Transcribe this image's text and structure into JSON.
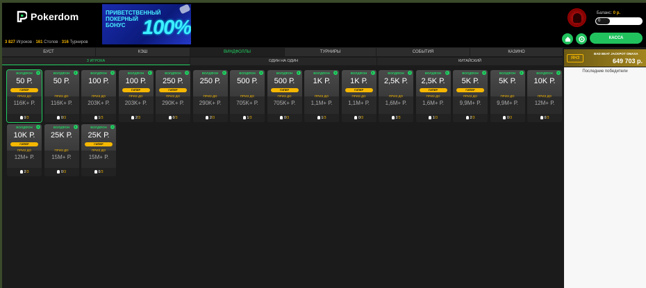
{
  "brand": {
    "name": "Pokerdom"
  },
  "stats": {
    "players_value": "3 827",
    "players_label": "Игроков",
    "tables_value": "161",
    "tables_label": "Столов",
    "tournaments_value": "316",
    "tournaments_label": "Турниров"
  },
  "banner": {
    "lines": [
      "ПРИВЕТСТВЕННЫЙ",
      "ПОКЕРНЫЙ",
      "БОНУС"
    ],
    "percent": "100%"
  },
  "account": {
    "balance_label": "Баланс:",
    "balance_value": "0 р.",
    "toggle_value": "0",
    "cashier_label": "КАССА"
  },
  "tabs_main": [
    {
      "label": "БУСТ",
      "active": false
    },
    {
      "label": "КЭШ",
      "active": false
    },
    {
      "label": "ВИНДФОЛЛЫ",
      "active": true
    },
    {
      "label": "ТУРНИРЫ",
      "active": false
    },
    {
      "label": "СОБЫТИЯ",
      "active": false
    },
    {
      "label": "КАЗИНО",
      "active": false
    }
  ],
  "tabs_sub": [
    {
      "label": "3 ИГРОКА",
      "active": true
    },
    {
      "label": "ОДИН НА ОДИН",
      "active": false
    },
    {
      "label": "КИТАЙСКИЙ",
      "active": false
    }
  ],
  "cards": [
    {
      "tag": "ВОЛДФОН",
      "bet": "50 Р.",
      "hyper": "ГИПЕР",
      "prize_label": "ПРИЗ ДО",
      "prize": "116K+ Р.",
      "players": "0",
      "max": "3",
      "selected": true
    },
    {
      "tag": "ВОЛДФОН",
      "bet": "50 Р.",
      "hyper": "",
      "prize_label": "ПРИЗ ДО",
      "prize": "116K+ Р.",
      "players": "0",
      "max": "3",
      "selected": false
    },
    {
      "tag": "ВОЛДФОН",
      "bet": "100 Р.",
      "hyper": "",
      "prize_label": "ПРИЗ ДО",
      "prize": "203K+ Р.",
      "players": "1",
      "max": "3",
      "selected": false
    },
    {
      "tag": "ВОЛДФОН",
      "bet": "100 Р.",
      "hyper": "ГИПЕР",
      "prize_label": "ПРИЗ ДО",
      "prize": "203K+ Р.",
      "players": "2",
      "max": "3",
      "selected": false
    },
    {
      "tag": "ВОЛДФОН",
      "bet": "250 Р.",
      "hyper": "ГИПЕР",
      "prize_label": "ПРИЗ ДО",
      "prize": "290K+ Р.",
      "players": "0",
      "max": "3",
      "selected": false
    },
    {
      "tag": "ВОЛДФОН",
      "bet": "250 Р.",
      "hyper": "",
      "prize_label": "ПРИЗ ДО",
      "prize": "290K+ Р.",
      "players": "2",
      "max": "3",
      "selected": false
    },
    {
      "tag": "ВОЛДФОН",
      "bet": "500 Р.",
      "hyper": "",
      "prize_label": "ПРИЗ ДО",
      "prize": "705K+ Р.",
      "players": "1",
      "max": "3",
      "selected": false
    },
    {
      "tag": "ВОЛДФОН",
      "bet": "500 Р.",
      "hyper": "ГИПЕР",
      "prize_label": "ПРИЗ ДО",
      "prize": "705K+ Р.",
      "players": "0",
      "max": "3",
      "selected": false
    },
    {
      "tag": "ВОЛДФОН",
      "bet": "1K Р.",
      "hyper": "",
      "prize_label": "ПРИЗ ДО",
      "prize": "1,1M+ Р.",
      "players": "1",
      "max": "3",
      "selected": false
    },
    {
      "tag": "ВОЛДФОН",
      "bet": "1K Р.",
      "hyper": "ГИПЕР",
      "prize_label": "ПРИЗ ДО",
      "prize": "1,1M+ Р.",
      "players": "0",
      "max": "3",
      "selected": false
    },
    {
      "tag": "ВОЛДФОН",
      "bet": "2,5K Р.",
      "hyper": "",
      "prize_label": "ПРИЗ ДО",
      "prize": "1,6M+ Р.",
      "players": "2",
      "max": "3",
      "selected": false
    },
    {
      "tag": "ВОЛДФОН",
      "bet": "2,5K Р.",
      "hyper": "ГИПЕР",
      "prize_label": "ПРИЗ ДО",
      "prize": "1,6M+ Р.",
      "players": "1",
      "max": "3",
      "selected": false
    },
    {
      "tag": "ВОЛДФОН",
      "bet": "5K Р.",
      "hyper": "ГИПЕР",
      "prize_label": "ПРИЗ ДО",
      "prize": "9,9M+ Р.",
      "players": "2",
      "max": "3",
      "selected": false
    },
    {
      "tag": "ВОЛДФОН",
      "bet": "5K Р.",
      "hyper": "",
      "prize_label": "ПРИЗ ДО",
      "prize": "9,9M+ Р.",
      "players": "0",
      "max": "3",
      "selected": false
    },
    {
      "tag": "ВОЛДФОН",
      "bet": "10K Р.",
      "hyper": "",
      "prize_label": "ПРИЗ ДО",
      "prize": "12M+ Р.",
      "players": "0",
      "max": "3",
      "selected": false
    },
    {
      "tag": "ВОЛДФОН",
      "bet": "10K Р.",
      "hyper": "ГИПЕР",
      "prize_label": "ПРИЗ ДО",
      "prize": "12M+ Р.",
      "players": "2",
      "max": "3",
      "selected": false
    },
    {
      "tag": "ВОЛДФОН",
      "bet": "25K Р.",
      "hyper": "",
      "prize_label": "ПРИЗ ДО",
      "prize": "15M+ Р.",
      "players": "0",
      "max": "3",
      "selected": false
    },
    {
      "tag": "ВОЛДФОН",
      "bet": "25K Р.",
      "hyper": "ГИПЕР",
      "prize_label": "ПРИЗ ДО",
      "prize": "15M+ Р.",
      "players": "0",
      "max": "3",
      "selected": false
    }
  ],
  "jackpot": {
    "badge": "ЯНЗ",
    "label": "BAD BEAT JACKPOT ОМАХА",
    "value": "649 703 р."
  },
  "winners": {
    "title": "Последние победители"
  },
  "colors": {
    "accent": "#21d061",
    "gold": "#f5b700",
    "bg": "#1b1b1b"
  }
}
